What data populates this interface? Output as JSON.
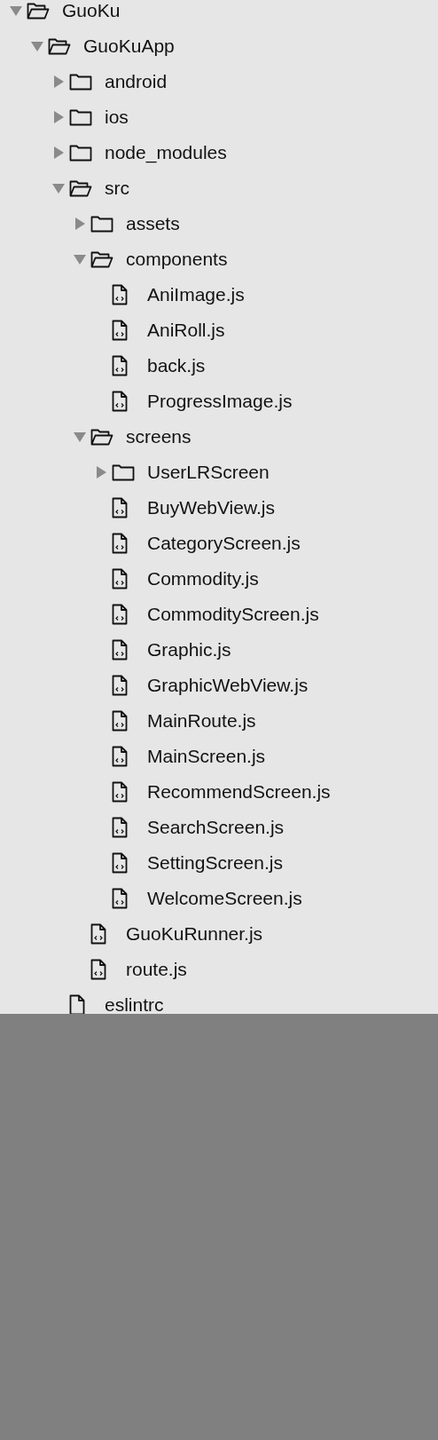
{
  "tree": [
    {
      "name": "GuoKu",
      "kind": "folder",
      "expanded": true,
      "children": [
        {
          "name": "GuoKuApp",
          "kind": "folder",
          "expanded": true,
          "children": [
            {
              "name": "android",
              "kind": "folder",
              "expanded": false
            },
            {
              "name": "ios",
              "kind": "folder",
              "expanded": false
            },
            {
              "name": "node_modules",
              "kind": "folder",
              "expanded": false
            },
            {
              "name": "src",
              "kind": "folder",
              "expanded": true,
              "children": [
                {
                  "name": "assets",
                  "kind": "folder",
                  "expanded": false
                },
                {
                  "name": "components",
                  "kind": "folder",
                  "expanded": true,
                  "children": [
                    {
                      "name": "AniImage.js",
                      "kind": "script"
                    },
                    {
                      "name": "AniRoll.js",
                      "kind": "script"
                    },
                    {
                      "name": "back.js",
                      "kind": "script"
                    },
                    {
                      "name": "ProgressImage.js",
                      "kind": "script"
                    }
                  ]
                },
                {
                  "name": "screens",
                  "kind": "folder",
                  "expanded": true,
                  "children": [
                    {
                      "name": "UserLRScreen",
                      "kind": "folder",
                      "expanded": false
                    },
                    {
                      "name": "BuyWebView.js",
                      "kind": "script"
                    },
                    {
                      "name": "CategoryScreen.js",
                      "kind": "script"
                    },
                    {
                      "name": "Commodity.js",
                      "kind": "script"
                    },
                    {
                      "name": "CommodityScreen.js",
                      "kind": "script"
                    },
                    {
                      "name": "Graphic.js",
                      "kind": "script"
                    },
                    {
                      "name": "GraphicWebView.js",
                      "kind": "script"
                    },
                    {
                      "name": "MainRoute.js",
                      "kind": "script"
                    },
                    {
                      "name": "MainScreen.js",
                      "kind": "script"
                    },
                    {
                      "name": "RecommendScreen.js",
                      "kind": "script"
                    },
                    {
                      "name": "SearchScreen.js",
                      "kind": "script"
                    },
                    {
                      "name": "SettingScreen.js",
                      "kind": "script"
                    },
                    {
                      "name": "WelcomeScreen.js",
                      "kind": "script"
                    }
                  ]
                },
                {
                  "name": "GuoKuRunner.js",
                  "kind": "script"
                },
                {
                  "name": "route.js",
                  "kind": "script"
                }
              ]
            },
            {
              "name": "eslintrc",
              "kind": "file"
            }
          ]
        }
      ]
    }
  ]
}
